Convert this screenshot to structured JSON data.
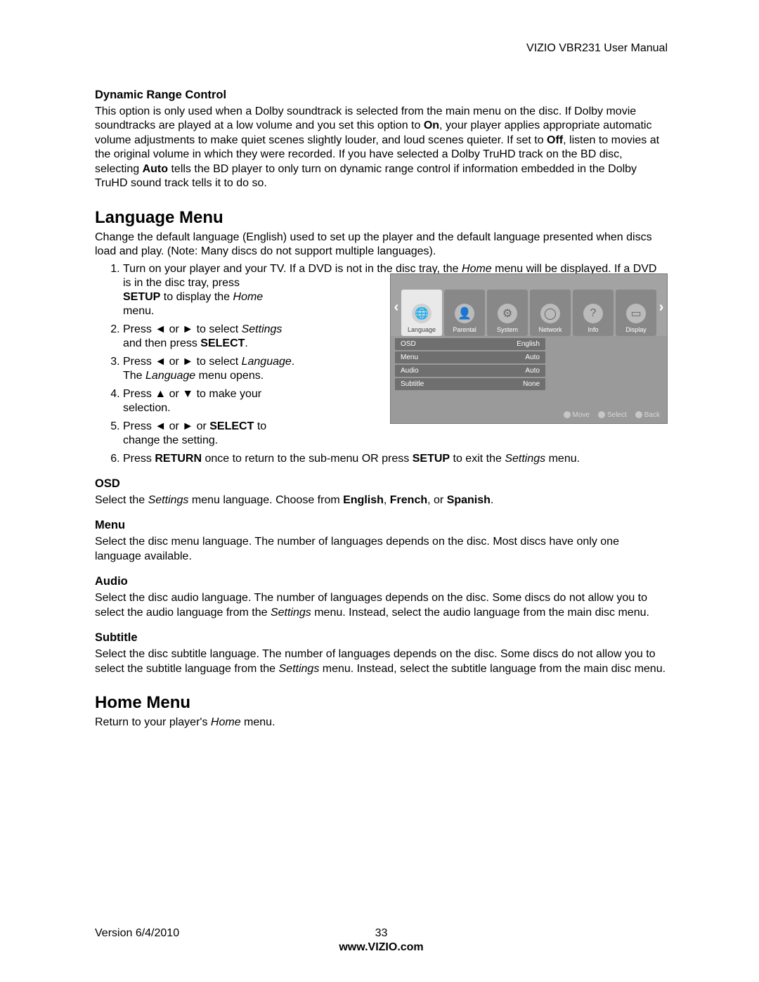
{
  "header": {
    "right": "VIZIO VBR231 User Manual"
  },
  "drc": {
    "title": "Dynamic Range Control",
    "p1a": "This option is only used when a Dolby soundtrack is selected from the main menu on the disc. If Dolby movie soundtracks are played at a low volume and you set this option to ",
    "p1b": "On",
    "p1c": ", your player applies appropriate automatic volume adjustments to make quiet scenes slightly louder, and loud scenes quieter. If set to ",
    "p1d": "Off",
    "p1e": ", listen to movies at the original volume in which they were recorded. If you have selected a Dolby TruHD track on the BD disc, selecting ",
    "p1f": "Auto",
    "p1g": " tells the BD player to only turn on dynamic range control if information embedded in the Dolby TruHD sound track tells it to do so."
  },
  "lang": {
    "title": "Language Menu",
    "intro": "Change the default language (English) used to set up the player and the default language presented when discs load and play. (Note: Many discs do not support multiple languages).",
    "s1a": "Turn on your player and your TV. If a DVD is not in the disc tray, the ",
    "s1b": "Home",
    "s1c": " menu will be displayed. If a DVD is in the disc tray, press ",
    "s1d": "SETUP",
    "s1e": " to display the ",
    "s1f": "Home",
    "s1g": " menu.",
    "s2a": "Press ◄ or ► to select ",
    "s2b": "Settings",
    "s2c": " and then press ",
    "s2d": "SELECT",
    "s2e": ".",
    "s3a": "Press ◄ or ► to select ",
    "s3b": "Language",
    "s3c": ". The ",
    "s3d": "Language",
    "s3e": " menu opens.",
    "s4": "Press ▲ or ▼ to make your selection.",
    "s5a": "Press ◄ or ► or ",
    "s5b": "SELECT",
    "s5c": " to change the setting.",
    "s6a": "Press ",
    "s6b": "RETURN",
    "s6c": " once to return to the sub-menu OR press ",
    "s6d": "SETUP",
    "s6e": " to exit the ",
    "s6f": "Settings",
    "s6g": " menu."
  },
  "menu": {
    "tabs": [
      "Language",
      "Parental",
      "System",
      "Network",
      "Info",
      "Display"
    ],
    "rows": [
      {
        "label": "OSD",
        "value": "English"
      },
      {
        "label": "Menu",
        "value": "Auto"
      },
      {
        "label": "Audio",
        "value": "Auto"
      },
      {
        "label": "Subtitle",
        "value": "None"
      }
    ],
    "hints": [
      "Move",
      "Select",
      "Back"
    ]
  },
  "osd": {
    "title": "OSD",
    "pa": "Select the ",
    "pb": "Settings",
    "pc": " menu language. Choose from ",
    "pd": "English",
    "pe": ", ",
    "pf": "French",
    "pg": ", or ",
    "ph": "Spanish",
    "pi": "."
  },
  "menuSec": {
    "title": "Menu",
    "p": "Select the disc menu language. The number of languages depends on the disc. Most discs have only one language available."
  },
  "audio": {
    "title": "Audio",
    "pa": "Select the disc audio language. The number of languages depends on the disc. Some discs do not allow you to select the audio language from the ",
    "pb": "Settings",
    "pc": " menu. Instead, select the audio language from the main disc menu."
  },
  "subtitle": {
    "title": "Subtitle",
    "pa": "Select the disc subtitle language. The number of languages depends on the disc. Some discs do not allow you to select the subtitle language from the ",
    "pb": "Settings",
    "pc": " menu. Instead, select the subtitle language from the main disc menu."
  },
  "home": {
    "title": "Home Menu",
    "pa": "Return to your player's ",
    "pb": "Home",
    "pc": " menu."
  },
  "footer": {
    "version": "Version 6/4/2010",
    "page": "33",
    "url": "www.VIZIO.com"
  }
}
